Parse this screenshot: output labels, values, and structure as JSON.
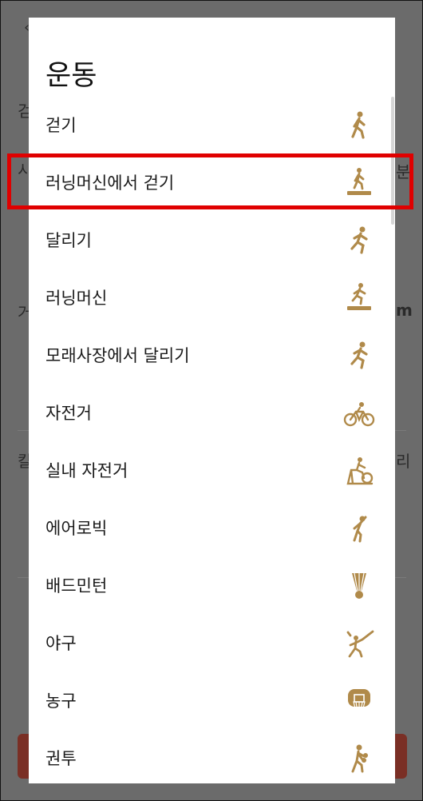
{
  "dialog": {
    "title": "운동",
    "items": [
      {
        "label": "걷기",
        "icon": "walking-icon"
      },
      {
        "label": "러닝머신에서 걷기",
        "icon": "treadmill-walk-icon"
      },
      {
        "label": "달리기",
        "icon": "running-icon"
      },
      {
        "label": "러닝머신",
        "icon": "treadmill-run-icon"
      },
      {
        "label": "모래사장에서 달리기",
        "icon": "running-icon"
      },
      {
        "label": "자전거",
        "icon": "bicycle-icon"
      },
      {
        "label": "실내 자전거",
        "icon": "indoor-bike-icon"
      },
      {
        "label": "에어로빅",
        "icon": "aerobics-icon"
      },
      {
        "label": "배드민턴",
        "icon": "shuttlecock-icon"
      },
      {
        "label": "야구",
        "icon": "baseball-icon"
      },
      {
        "label": "농구",
        "icon": "basketball-icon"
      },
      {
        "label": "권투",
        "icon": "boxing-icon"
      }
    ],
    "selected_index": 1
  },
  "background": {
    "frag_left": [
      "걷",
      "시",
      "거",
      "칼"
    ],
    "frag_right": [
      "분",
      "m",
      "리"
    ]
  },
  "colors": {
    "icon": "#b08a4a",
    "highlight": "#e00000",
    "scrim": "#6b6b6b"
  }
}
